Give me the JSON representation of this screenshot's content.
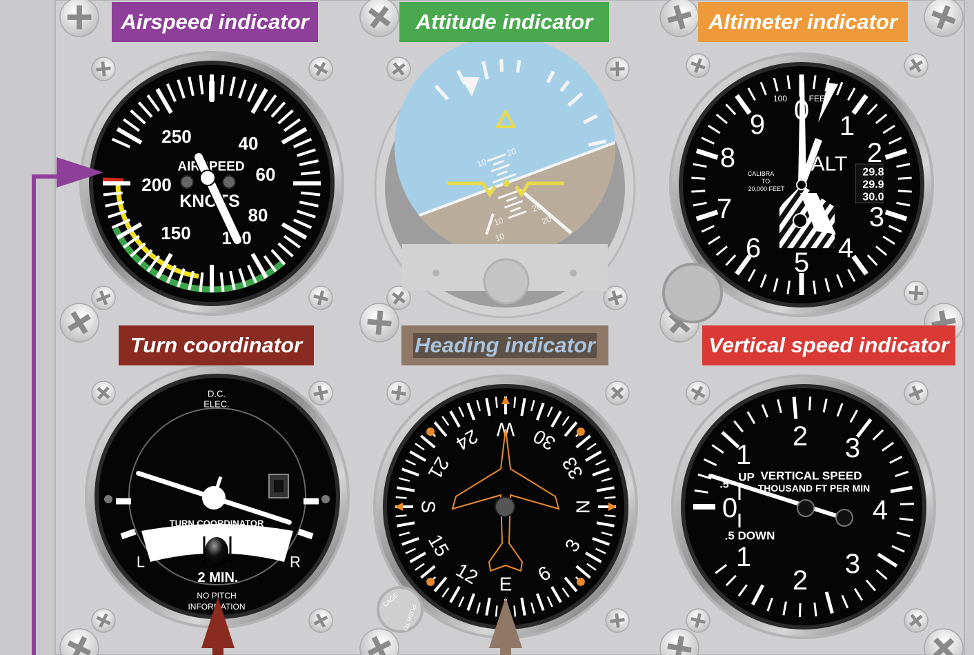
{
  "colors": {
    "airspeed": "#8e3f99",
    "attitude": "#4aa84f",
    "altimeter": "#ee9a3b",
    "turn": "#8a2b22",
    "heading": "#8f7866",
    "vsi": "#d93a35",
    "panel": "#c9c9cb"
  },
  "labels": {
    "airspeed": "Airspeed indicator",
    "attitude": "Attitude indicator",
    "altimeter": "Altimeter indicator",
    "turn": "Turn coordinator",
    "heading": "Heading indicator",
    "vsi": "Vertical speed indicator"
  },
  "airspeed": {
    "title1": "AIRSPEED",
    "title2": "KNOTS",
    "numbers": [
      "40",
      "60",
      "80",
      "100",
      "150",
      "200",
      "250"
    ]
  },
  "attitude": {
    "pitch_marks": [
      "10",
      "20",
      "10",
      "20",
      "10",
      "20"
    ]
  },
  "altimeter": {
    "numbers": [
      "0",
      "1",
      "2",
      "3",
      "4",
      "5",
      "6",
      "7",
      "8",
      "9"
    ],
    "alt_label": "ALT",
    "top_left": "100",
    "top_right": "FEET",
    "calibra": [
      "CALIBRA",
      "TO",
      "20,000 FEET"
    ],
    "baro": [
      "29.8",
      "29.9",
      "30.0"
    ]
  },
  "turn": {
    "dc1": "D.C.",
    "dc2": "ELEC.",
    "title": "TURN COORDINATOR",
    "left": "L",
    "right": "R",
    "min": "2  MIN.",
    "pitch1": "NO  PITCH",
    "pitch2": "INFORMATION"
  },
  "heading": {
    "cardinals": [
      "N",
      "E",
      "S",
      "W"
    ],
    "numbers": [
      "3",
      "6",
      "12",
      "15",
      "21",
      "24",
      "30",
      "33"
    ],
    "knob1": "CAGE",
    "knob2": "PUSH TO"
  },
  "vsi": {
    "title1": "VERTICAL SPEED",
    "title2": "THOUSAND FT PER MIN",
    "up": "UP",
    "down": ".5 DOWN",
    "numbers": [
      "0",
      "1",
      "2",
      "3",
      "4",
      "1",
      "2",
      "3"
    ],
    "half": ".5"
  }
}
